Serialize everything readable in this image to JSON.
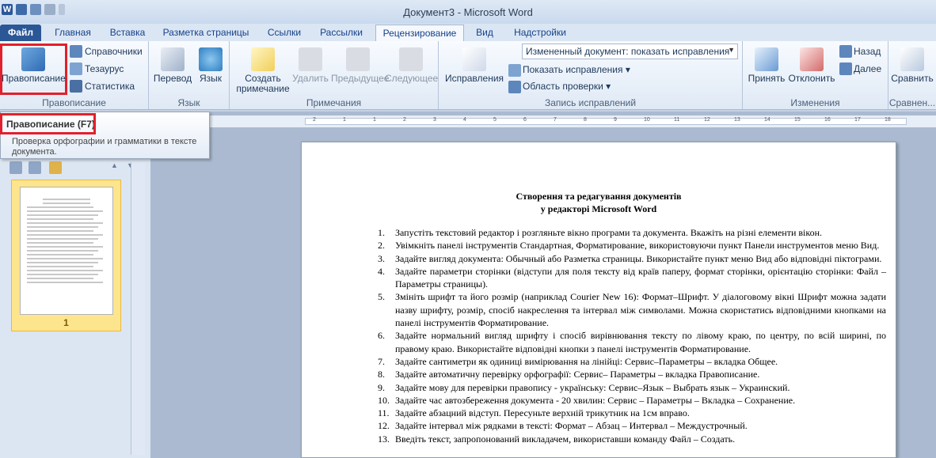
{
  "window": {
    "title": "Документ3 - Microsoft Word",
    "logo": "W"
  },
  "tabs": [
    {
      "label": "Файл"
    },
    {
      "label": "Главная"
    },
    {
      "label": "Вставка"
    },
    {
      "label": "Разметка страницы"
    },
    {
      "label": "Ссылки"
    },
    {
      "label": "Рассылки"
    },
    {
      "label": "Рецензирование"
    },
    {
      "label": "Вид"
    },
    {
      "label": "Надстройки"
    }
  ],
  "ribbon": {
    "spelling": {
      "label": "Правописание",
      "reference": "Справочники",
      "thesaurus": "Тезаурус",
      "stats": "Статистика",
      "group": "Правописание"
    },
    "language": {
      "translate": "Перевод",
      "language": "Язык",
      "group": "Язык"
    },
    "comments": {
      "create": "Создать примечание",
      "delete": "Удалить",
      "prev": "Предыдущее",
      "next": "Следующее",
      "group": "Примечания"
    },
    "tracking": {
      "corrections": "Исправления",
      "mode": "Измененный документ: показать исправления",
      "show": "Показать исправления",
      "area": "Область проверки",
      "group": "Запись исправлений"
    },
    "changes": {
      "accept": "Принять",
      "reject": "Отклонить",
      "back": "Назад",
      "forward": "Далее",
      "group": "Изменения"
    },
    "compare": {
      "label": "Сравнить",
      "group": "Сравнен..."
    }
  },
  "tooltip": {
    "title": "Правописание (F7)",
    "desc": "Проверка орфографии и грамматики в тексте документа."
  },
  "nav": {
    "page_number": "1"
  },
  "document": {
    "title1": "Створення та редагування документів",
    "title2": "у редакторі Microsoft Word",
    "items": [
      {
        "n": "1.",
        "text": "Запустіть текстовий редактор і розгляньте вікно програми та документа. Вкажіть на різні елементи вікон."
      },
      {
        "n": "2.",
        "text": "Увімкніть панелі інструментів Стандартная, Форматирование, використовуючи пункт Панели инструментов меню Вид."
      },
      {
        "n": "3.",
        "text": "Задайте вигляд документа: Обычный або Разметка страницы. Використайте пункт меню Вид або відповідні піктограми."
      },
      {
        "n": "4.",
        "text": "Задайте параметри сторінки (відступи для поля тексту від країв паперу, формат сторінки, орієнтацію сторінки: Файл – Параметры страницы)."
      },
      {
        "n": "5.",
        "text": "Змініть шрифт та його розмір (наприклад Courier New 16): Формат–Шрифт. У діалоговому вікні Шрифт можна задати назву шрифту, розмір, спосіб накреслення та інтервал між символами. Можна скористатись відповідними кнопками на панелі інструментів Форматирование."
      },
      {
        "n": "6.",
        "text": "Задайте нормальний вигляд шрифту і спосіб вирівнювання тексту по лівому краю, по центру, по всій ширині, по правому краю. Використайте відповідні кнопки з панелі інструментів Форматирование."
      },
      {
        "n": "7.",
        "text": "Задайте сантиметри як одиниці вимірювання на лінійці: Сервис–Параметры – вкладка Общее."
      },
      {
        "n": "8.",
        "text": "Задайте автоматичну перевірку орфографії: Сервис– Параметры – вкладка Правописание."
      },
      {
        "n": "9.",
        "text": "Задайте мову для перевірки правопису - українську: Сервис–Язык – Выбрать язык – Украинский."
      },
      {
        "n": "10.",
        "text": "Задайте час автозбереження документа - 20 хвилин: Сервис – Параметры – Вкладка – Сохранение."
      },
      {
        "n": "11.",
        "text": "Задайте абзацний відступ. Пересуньте верхній трикутник на 1см вправо."
      },
      {
        "n": "12.",
        "text": "Задайте інтервал між рядками в тексті: Формат – Абзац – Интервал – Междустрочный."
      },
      {
        "n": "13.",
        "text": "Введіть текст, запропонований викладачем, використавши команду Файл – Создать."
      }
    ]
  },
  "ruler": {
    "ticks": [
      "2",
      "1",
      "1",
      "2",
      "3",
      "4",
      "5",
      "6",
      "7",
      "8",
      "9",
      "10",
      "11",
      "12",
      "13",
      "14",
      "15",
      "16",
      "17",
      "18"
    ]
  }
}
